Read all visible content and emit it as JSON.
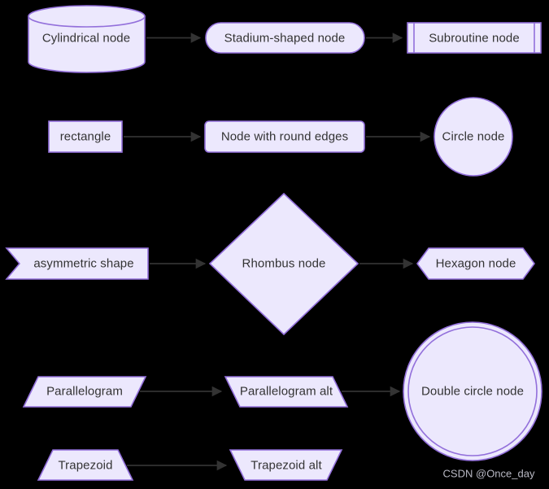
{
  "diagram": {
    "title": "Mermaid flowchart node shapes",
    "background_color": "#000000",
    "node_fill": "#ECE8FD",
    "node_stroke": "#9370DB",
    "edge_color": "#333333",
    "label_color": "#333333"
  },
  "nodes": [
    {
      "id": "cylindrical",
      "label": "Cylindrical node",
      "shape": "cylinder"
    },
    {
      "id": "stadium",
      "label": "Stadium-shaped node",
      "shape": "stadium"
    },
    {
      "id": "subroutine",
      "label": "Subroutine node",
      "shape": "subroutine"
    },
    {
      "id": "rectangle",
      "label": "rectangle",
      "shape": "rectangle"
    },
    {
      "id": "round-edges",
      "label": "Node with round edges",
      "shape": "round-rectangle"
    },
    {
      "id": "circle",
      "label": "Circle node",
      "shape": "circle"
    },
    {
      "id": "asymmetric",
      "label": "asymmetric shape",
      "shape": "asymmetric"
    },
    {
      "id": "rhombus",
      "label": "Rhombus node",
      "shape": "rhombus"
    },
    {
      "id": "hexagon",
      "label": "Hexagon node",
      "shape": "hexagon"
    },
    {
      "id": "parallelogram",
      "label": "Parallelogram",
      "shape": "parallelogram"
    },
    {
      "id": "parallelogram-alt",
      "label": "Parallelogram alt",
      "shape": "parallelogram-alt"
    },
    {
      "id": "double-circle",
      "label": "Double circle node",
      "shape": "double-circle"
    },
    {
      "id": "trapezoid",
      "label": "Trapezoid",
      "shape": "trapezoid"
    },
    {
      "id": "trapezoid-alt",
      "label": "Trapezoid alt",
      "shape": "trapezoid-alt"
    }
  ],
  "edges": [
    {
      "from": "cylindrical",
      "to": "stadium"
    },
    {
      "from": "stadium",
      "to": "subroutine"
    },
    {
      "from": "rectangle",
      "to": "round-edges"
    },
    {
      "from": "round-edges",
      "to": "circle"
    },
    {
      "from": "asymmetric",
      "to": "rhombus"
    },
    {
      "from": "rhombus",
      "to": "hexagon"
    },
    {
      "from": "parallelogram",
      "to": "parallelogram-alt"
    },
    {
      "from": "parallelogram-alt",
      "to": "double-circle"
    },
    {
      "from": "trapezoid",
      "to": "trapezoid-alt"
    }
  ],
  "watermark": {
    "text": "CSDN @Once_day"
  }
}
